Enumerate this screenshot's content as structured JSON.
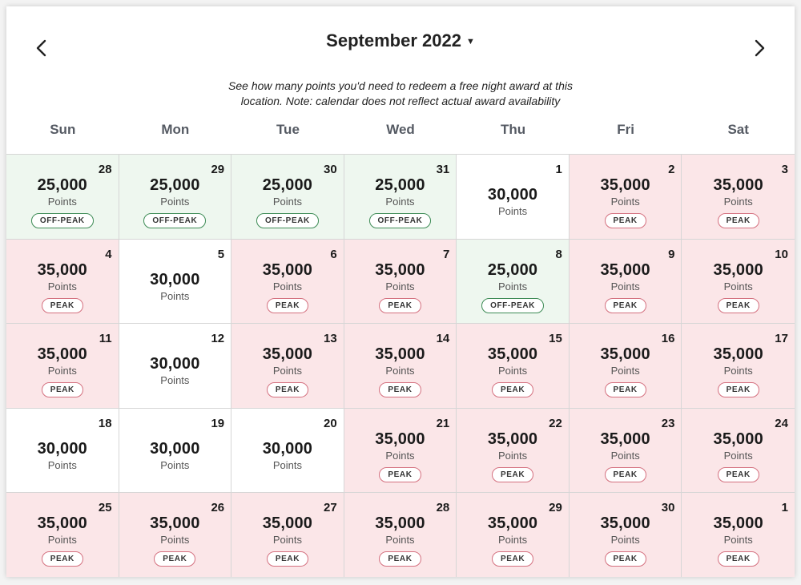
{
  "header": {
    "title": "September 2022",
    "note_line1": "See how many points you'd need to redeem a free night award at this",
    "note_line2": "location. Note: calendar does not reflect actual award availability"
  },
  "weekdays": [
    "Sun",
    "Mon",
    "Tue",
    "Wed",
    "Thu",
    "Fri",
    "Sat"
  ],
  "colors": {
    "peak_bg": "#fbe6e8",
    "off_peak_bg": "#eef7ef",
    "standard_bg": "#ffffff",
    "peak_border": "#d4707f",
    "off_peak_border": "#3d8b55"
  },
  "points_unit": "Points",
  "tags": {
    "peak": "PEAK",
    "off_peak": "OFF-PEAK"
  },
  "days": [
    {
      "date": "28",
      "points": "25,000",
      "type": "off-peak"
    },
    {
      "date": "29",
      "points": "25,000",
      "type": "off-peak"
    },
    {
      "date": "30",
      "points": "25,000",
      "type": "off-peak"
    },
    {
      "date": "31",
      "points": "25,000",
      "type": "off-peak"
    },
    {
      "date": "1",
      "points": "30,000",
      "type": "standard"
    },
    {
      "date": "2",
      "points": "35,000",
      "type": "peak"
    },
    {
      "date": "3",
      "points": "35,000",
      "type": "peak"
    },
    {
      "date": "4",
      "points": "35,000",
      "type": "peak"
    },
    {
      "date": "5",
      "points": "30,000",
      "type": "standard"
    },
    {
      "date": "6",
      "points": "35,000",
      "type": "peak"
    },
    {
      "date": "7",
      "points": "35,000",
      "type": "peak"
    },
    {
      "date": "8",
      "points": "25,000",
      "type": "off-peak"
    },
    {
      "date": "9",
      "points": "35,000",
      "type": "peak"
    },
    {
      "date": "10",
      "points": "35,000",
      "type": "peak"
    },
    {
      "date": "11",
      "points": "35,000",
      "type": "peak"
    },
    {
      "date": "12",
      "points": "30,000",
      "type": "standard"
    },
    {
      "date": "13",
      "points": "35,000",
      "type": "peak"
    },
    {
      "date": "14",
      "points": "35,000",
      "type": "peak"
    },
    {
      "date": "15",
      "points": "35,000",
      "type": "peak"
    },
    {
      "date": "16",
      "points": "35,000",
      "type": "peak"
    },
    {
      "date": "17",
      "points": "35,000",
      "type": "peak"
    },
    {
      "date": "18",
      "points": "30,000",
      "type": "standard"
    },
    {
      "date": "19",
      "points": "30,000",
      "type": "standard"
    },
    {
      "date": "20",
      "points": "30,000",
      "type": "standard"
    },
    {
      "date": "21",
      "points": "35,000",
      "type": "peak"
    },
    {
      "date": "22",
      "points": "35,000",
      "type": "peak"
    },
    {
      "date": "23",
      "points": "35,000",
      "type": "peak"
    },
    {
      "date": "24",
      "points": "35,000",
      "type": "peak"
    },
    {
      "date": "25",
      "points": "35,000",
      "type": "peak"
    },
    {
      "date": "26",
      "points": "35,000",
      "type": "peak"
    },
    {
      "date": "27",
      "points": "35,000",
      "type": "peak"
    },
    {
      "date": "28",
      "points": "35,000",
      "type": "peak"
    },
    {
      "date": "29",
      "points": "35,000",
      "type": "peak"
    },
    {
      "date": "30",
      "points": "35,000",
      "type": "peak"
    },
    {
      "date": "1",
      "points": "35,000",
      "type": "peak"
    }
  ]
}
